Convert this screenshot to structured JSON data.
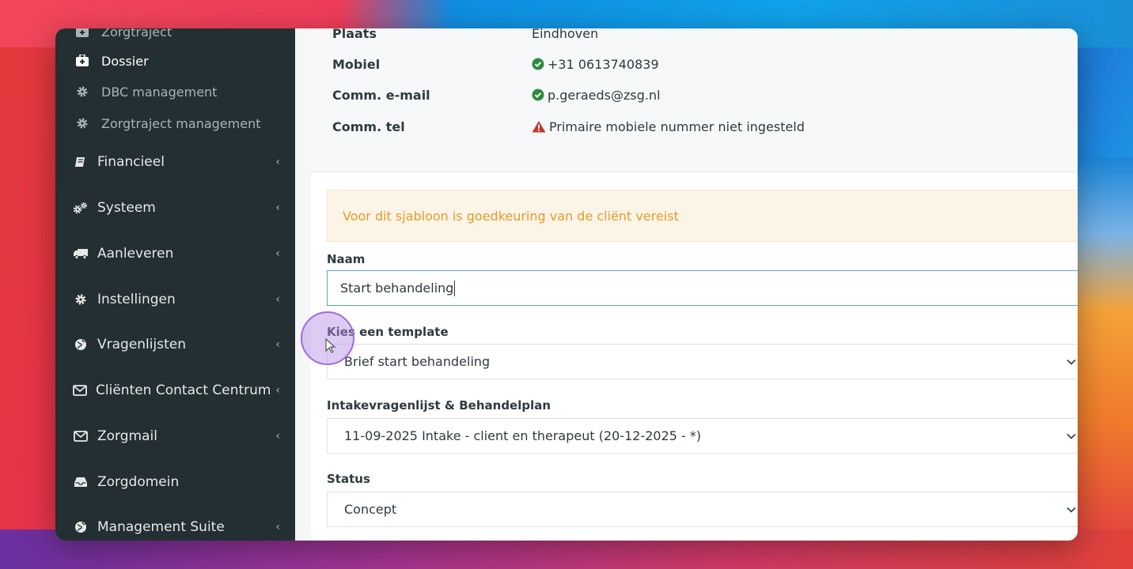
{
  "sidebar": {
    "sub_items": [
      {
        "label": "Zorgtraject",
        "icon": "medkit-icon"
      },
      {
        "label": "Dossier",
        "icon": "medkit-icon"
      },
      {
        "label": "DBC management",
        "icon": "gear-icon"
      },
      {
        "label": "Zorgtraject management",
        "icon": "gear-icon"
      }
    ],
    "nav_items": [
      {
        "label": "Financieel",
        "icon": "book-icon"
      },
      {
        "label": "Systeem",
        "icon": "gears-icon"
      },
      {
        "label": "Aanleveren",
        "icon": "truck-icon"
      },
      {
        "label": "Instellingen",
        "icon": "gear-icon"
      },
      {
        "label": "Vragenlijsten",
        "icon": "globe-icon"
      },
      {
        "label": "Cliënten Contact Centrum",
        "icon": "envelope-icon"
      },
      {
        "label": "Zorgmail",
        "icon": "envelope-icon"
      },
      {
        "label": "Zorgdomein",
        "icon": "inbox-icon"
      },
      {
        "label": "Management Suite",
        "icon": "globe-icon"
      }
    ],
    "chevron": "‹"
  },
  "client_info": [
    {
      "key": "Plaats",
      "value": "Eindhoven",
      "status": ""
    },
    {
      "key": "Mobiel",
      "value": "+31 0613740839",
      "status": "ok"
    },
    {
      "key": "Comm. e-mail",
      "value": "p.geraeds@zsg.nl",
      "status": "ok"
    },
    {
      "key": "Comm. tel",
      "value": "Primaire mobiele nummer niet ingesteld",
      "status": "warning"
    }
  ],
  "form": {
    "alert": "Voor dit sjabloon is goedkeuring van de cliënt vereist",
    "name_label": "Naam",
    "name_value": "Start behandeling",
    "template_label": "Kies een template",
    "template_value": "Brief start behandeling",
    "intake_label": "Intakevragenlijst & Behandelplan",
    "intake_value": "11-09-2025 Intake - client en therapeut (20-12-2025 - *)",
    "status_label": "Status",
    "status_value": "Concept"
  },
  "colors": {
    "sidebar_bg": "#232f33",
    "ok": "#2e8b3d",
    "warning": "#c0392b",
    "alert_text": "#e29c2a"
  }
}
